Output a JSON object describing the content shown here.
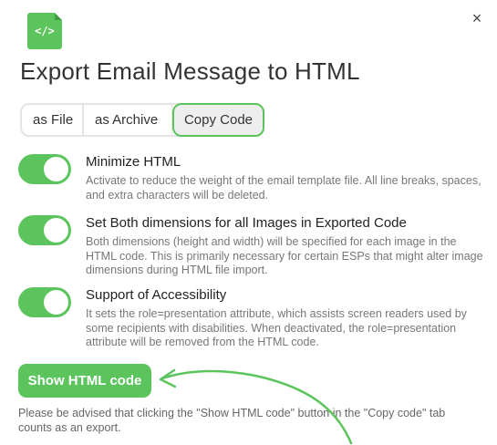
{
  "dialog": {
    "title": "Export Email Message to HTML",
    "close_symbol": "×",
    "logo_icon": "code-file-icon",
    "logo_symbol": "</>"
  },
  "tabs": [
    {
      "label": "as File",
      "active": false
    },
    {
      "label": "as Archive",
      "active": false
    },
    {
      "label": "Copy Code",
      "active": true
    }
  ],
  "options": [
    {
      "title": "Minimize HTML",
      "description": "Activate to reduce the weight of the email template file. All line breaks, spaces, and extra characters will be deleted.",
      "enabled": true
    },
    {
      "title": "Set Both dimensions for all Images in Exported Code",
      "description": "Both dimensions (height and width) will be specified for each image in the HTML code. This is primarily necessary for certain ESPs that might alter image dimensions during HTML file import.",
      "enabled": true
    },
    {
      "title": "Support of Accessibility",
      "description": "It sets the role=presentation attribute, which assists screen readers used by some recipients with disabilities. When deactivated, the role=presentation attribute will be removed from the HTML code.",
      "enabled": true
    }
  ],
  "show_button": {
    "label": "Show HTML code"
  },
  "note": "Please be advised that clicking the \"Show HTML code\" button in the \"Copy code\" tab counts as an export.",
  "colors": {
    "accent": "#5cc45c",
    "text": "#333333",
    "muted": "#777777"
  }
}
